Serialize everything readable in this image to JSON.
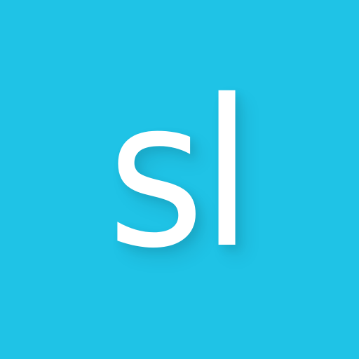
{
  "logo": {
    "text": "sl"
  },
  "colors": {
    "background": "#1fc3e6",
    "foreground": "#ffffff"
  }
}
